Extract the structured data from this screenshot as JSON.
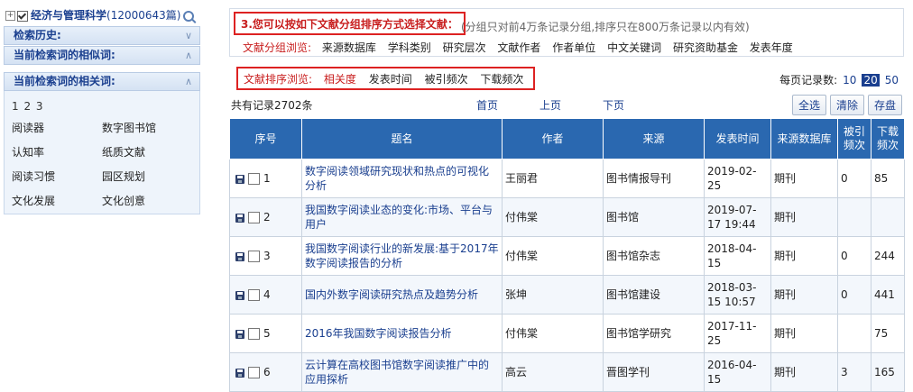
{
  "sidebar": {
    "category": {
      "name": "经济与管理科学",
      "count": "(12000643篇)"
    },
    "sections": [
      {
        "title": "检索历史:",
        "toggle": "∨"
      },
      {
        "title": "当前检索词的相似词:",
        "toggle": "∧"
      }
    ],
    "related": {
      "title": "当前检索词的相关词:",
      "toggle": "∧",
      "pages": "1 2 3",
      "words": [
        "阅读器",
        "数字图书馆",
        "认知率",
        "纸质文献",
        "阅读习惯",
        "园区规划",
        "文化发展",
        "文化创意"
      ]
    }
  },
  "filter": {
    "hint_title": "3.您可以按如下文献分组排序方式选择文献：",
    "hint_note": "(分组只对前4万条记录分组,排序只在800万条记录以内有效)",
    "group_label": "文献分组浏览:",
    "group_items": [
      "来源数据库",
      "学科类别",
      "研究层次",
      "文献作者",
      "作者单位",
      "中文关键词",
      "研究资助基金",
      "发表年度"
    ]
  },
  "sort": {
    "label": "文献排序浏览:",
    "items": [
      "相关度",
      "发表时间",
      "被引频次",
      "下载频次"
    ],
    "perpage_label": "每页记录数:",
    "perpage": [
      "10",
      "20",
      "50"
    ]
  },
  "pager": {
    "total": "共有记录2702条",
    "first": "首页",
    "prev": "上页",
    "next": "下页",
    "buttons": [
      "全选",
      "清除",
      "存盘"
    ]
  },
  "table": {
    "headers": [
      "序号",
      "题名",
      "作者",
      "来源",
      "发表时间",
      "来源数据库",
      "被引频次",
      "下载频次"
    ],
    "rows": [
      {
        "idx": "1",
        "title": "数字阅读领域研究现状和热点的可视化分析",
        "author": "王丽君",
        "source": "图书情报导刊",
        "date": "2019-02-25",
        "db": "期刊",
        "cited": "0",
        "downloads": "85"
      },
      {
        "idx": "2",
        "title": "我国数字阅读业态的变化:市场、平台与用户",
        "author": "付伟棠",
        "source": "图书馆",
        "date": "2019-07-17 19:44",
        "db": "期刊",
        "cited": "",
        "downloads": ""
      },
      {
        "idx": "3",
        "title": "我国数字阅读行业的新发展:基于2017年数字阅读报告的分析",
        "author": "付伟棠",
        "source": "图书馆杂志",
        "date": "2018-04-15",
        "db": "期刊",
        "cited": "0",
        "downloads": "244"
      },
      {
        "idx": "4",
        "title": "国内外数字阅读研究热点及趋势分析",
        "author": "张坤",
        "source": "图书馆建设",
        "date": "2018-03-15 10:57",
        "db": "期刊",
        "cited": "0",
        "downloads": "441"
      },
      {
        "idx": "5",
        "title": "2016年我国数字阅读报告分析",
        "author": "付伟棠",
        "source": "图书馆学研究",
        "date": "2017-11-25",
        "db": "期刊",
        "cited": "",
        "downloads": "75"
      },
      {
        "idx": "6",
        "title": "云计算在高校图书馆数字阅读推广中的应用探析",
        "author": "高云",
        "source": "晋图学刊",
        "date": "2016-04-15",
        "db": "期刊",
        "cited": "3",
        "downloads": "165"
      }
    ]
  }
}
